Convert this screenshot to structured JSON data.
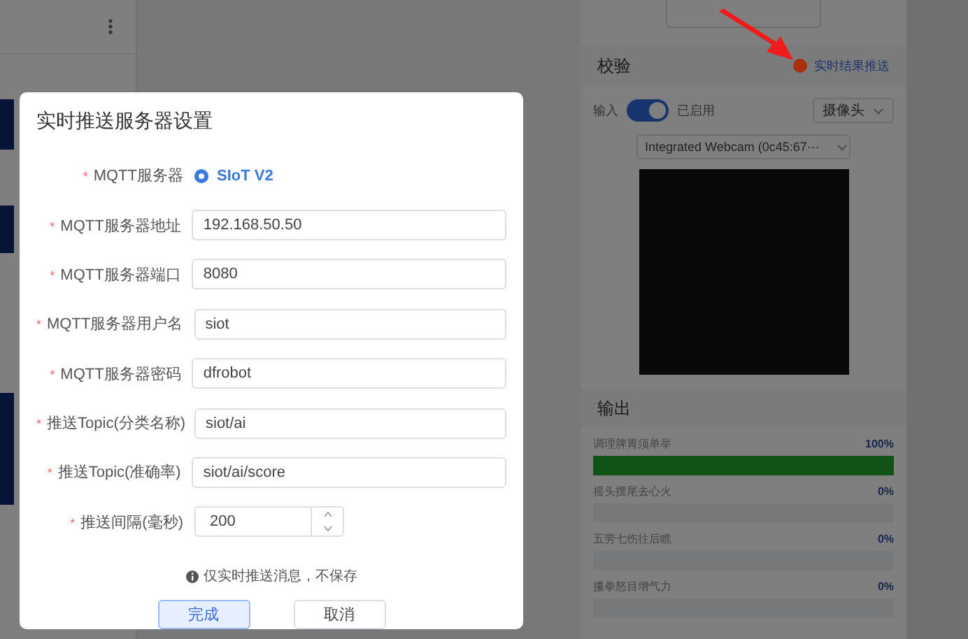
{
  "right_panel": {
    "verify": {
      "title": "校验",
      "push_status": {
        "color": "#a8300a",
        "label": "实时结果推送"
      },
      "input_label": "输入",
      "toggle": {
        "on": true,
        "label": "已启用"
      },
      "source_select": {
        "value": "摄像头"
      },
      "camera_select": {
        "value": "Integrated Webcam (0c45:67···"
      }
    },
    "output": {
      "title": "输出",
      "classes": [
        {
          "label": "调理脾胃须单举",
          "reading": "100%",
          "level": 1
        },
        {
          "label": "摇头摆尾去心火",
          "reading": "0%",
          "level": 0
        },
        {
          "label": "五劳七伤往后瞧",
          "reading": "0%",
          "level": 0
        },
        {
          "label": "攥拳怒目增气力",
          "reading": "0%",
          "level": 0
        }
      ]
    }
  },
  "dialog": {
    "title": "实时推送服务器设置",
    "fields": [
      {
        "kind": "radio",
        "required_mark": "*",
        "label": "MQTT服务器",
        "options": [
          {
            "label": "SIoT V2",
            "selected": true
          }
        ]
      },
      {
        "kind": "text",
        "required_mark": "*",
        "label": "MQTT服务器地址",
        "value": "192.168.50.50"
      },
      {
        "kind": "text",
        "required_mark": "*",
        "label": "MQTT服务器端口",
        "value": "8080"
      },
      {
        "kind": "text",
        "required_mark": "*",
        "label": "MQTT服务器用户名",
        "value": "siot"
      },
      {
        "kind": "text",
        "required_mark": "*",
        "label": "MQTT服务器密码",
        "value": "dfrobot"
      },
      {
        "kind": "text",
        "required_mark": "*",
        "label": "推送Topic(分类名称)",
        "value": "siot/ai"
      },
      {
        "kind": "text",
        "required_mark": "*",
        "label": "推送Topic(准确率)",
        "value": "siot/ai/score"
      },
      {
        "kind": "number",
        "required_mark": "*",
        "label": "推送间隔(毫秒)",
        "value": "200"
      }
    ],
    "note": "仅实时推送消息，不保存",
    "buttons": [
      {
        "label": "完成",
        "primary": true
      },
      {
        "label": "取消",
        "primary": false
      }
    ]
  }
}
